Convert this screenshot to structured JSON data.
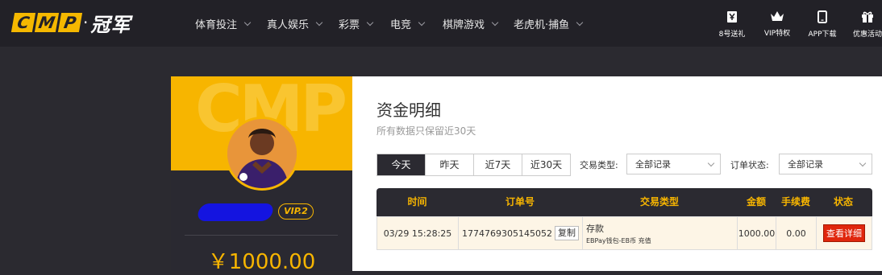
{
  "logo": {
    "letters": [
      "C",
      "M",
      "P"
    ],
    "dot": "·",
    "text": "冠军"
  },
  "nav": [
    {
      "label": "体育投注"
    },
    {
      "label": "真人娱乐"
    },
    {
      "label": "彩票"
    },
    {
      "label": "电竞"
    },
    {
      "label": "棋牌游戏"
    },
    {
      "label": "老虎机·捕鱼"
    }
  ],
  "header_actions": [
    {
      "label": "8号送礼",
      "icon": "gift-box-icon"
    },
    {
      "label": "VIP特权",
      "icon": "crown-icon"
    },
    {
      "label": "APP下载",
      "icon": "phone-icon"
    },
    {
      "label": "优惠活动",
      "icon": "present-icon"
    }
  ],
  "profile": {
    "watermark": "CMP",
    "vip": "VIP.2",
    "balance": "￥1000.00"
  },
  "page": {
    "title": "资金明细",
    "subtitle": "所有数据只保留近30天"
  },
  "tabs": [
    {
      "label": "今天",
      "active": true
    },
    {
      "label": "昨天",
      "active": false
    },
    {
      "label": "近7天",
      "active": false
    },
    {
      "label": "近30天",
      "active": false
    }
  ],
  "filters": {
    "type_label": "交易类型:",
    "type_value": "全部记录",
    "status_label": "订单状态:",
    "status_value": "全部记录"
  },
  "table": {
    "headers": [
      "时间",
      "订单号",
      "交易类型",
      "金额",
      "手续费",
      "状态"
    ],
    "rows": [
      {
        "time": "03/29 15:28:25",
        "order_no": "1774769305145052",
        "copy": "复制",
        "type": "存款",
        "type_detail": "EBPay钱包-EB币 充值",
        "amount": "1000.00",
        "fee": "0.00",
        "status_action": "查看详细"
      }
    ]
  },
  "colors": {
    "accent": "#f7b500",
    "header_bg": "#222127",
    "panel_bg": "#2b2a31",
    "button_red": "#e0260c"
  }
}
